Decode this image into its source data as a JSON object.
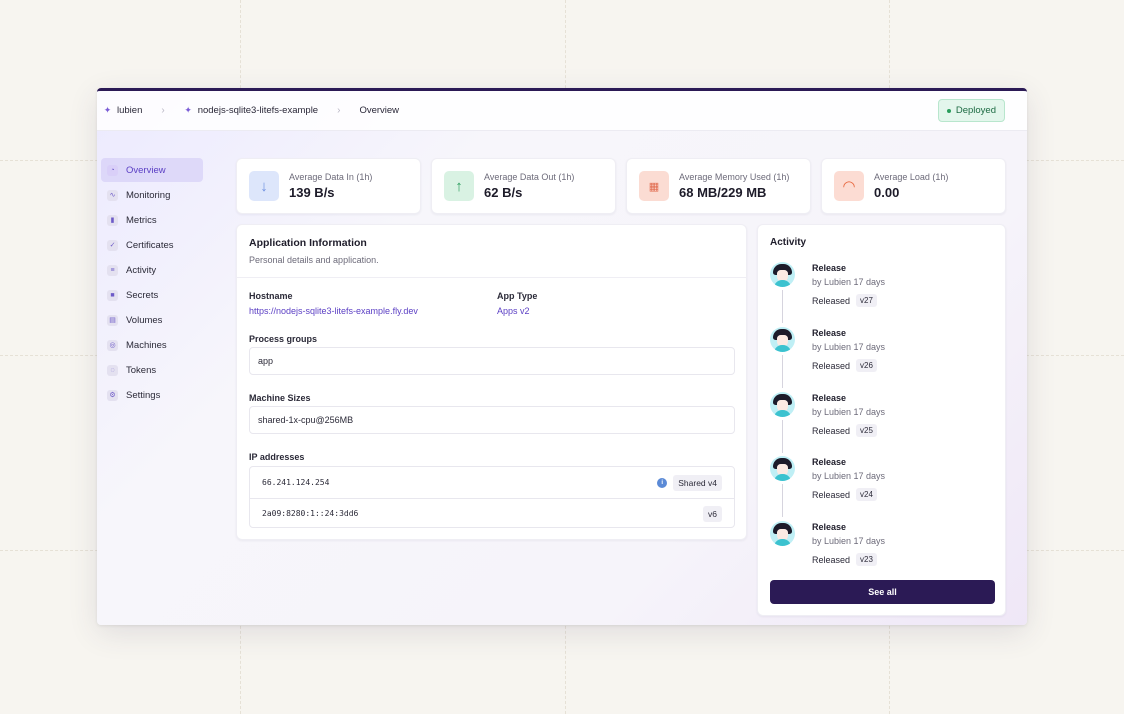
{
  "breadcrumb": {
    "org": "lubien",
    "app": "nodejs-sqlite3-litefs-example",
    "page": "Overview"
  },
  "status_badge": "Deployed",
  "sidebar": {
    "items": [
      {
        "label": "Overview",
        "icon": "overview-icon"
      },
      {
        "label": "Monitoring",
        "icon": "monitoring-icon"
      },
      {
        "label": "Metrics",
        "icon": "metrics-icon"
      },
      {
        "label": "Certificates",
        "icon": "certificates-icon"
      },
      {
        "label": "Activity",
        "icon": "activity-icon"
      },
      {
        "label": "Secrets",
        "icon": "secrets-icon"
      },
      {
        "label": "Volumes",
        "icon": "volumes-icon"
      },
      {
        "label": "Machines",
        "icon": "machines-icon"
      },
      {
        "label": "Tokens",
        "icon": "tokens-icon"
      },
      {
        "label": "Settings",
        "icon": "settings-icon"
      }
    ]
  },
  "stats": [
    {
      "label": "Average Data In (1h)",
      "value": "139 B/s",
      "icon": "download-icon",
      "color": "#6d8fe0"
    },
    {
      "label": "Average Data Out (1h)",
      "value": "62 B/s",
      "icon": "upload-icon",
      "color": "#2a9d5c"
    },
    {
      "label": "Average Memory Used (1h)",
      "value": "68 MB/229 MB",
      "icon": "memory-icon",
      "color": "#e06a4d"
    },
    {
      "label": "Average Load (1h)",
      "value": "0.00",
      "icon": "gauge-icon",
      "color": "#e8673e"
    }
  ],
  "app_info": {
    "title": "Application Information",
    "subtitle": "Personal details and application.",
    "hostname_label": "Hostname",
    "hostname": "https://nodejs-sqlite3-litefs-example.fly.dev",
    "app_type_label": "App Type",
    "app_type": "Apps v2",
    "process_groups_label": "Process groups",
    "process_groups": "app",
    "machine_sizes_label": "Machine Sizes",
    "machine_sizes": "shared-1x-cpu@256MB",
    "ip_label": "IP addresses",
    "ips": [
      {
        "address": "66.241.124.254",
        "type": "Shared v4"
      },
      {
        "address": "2a09:8280:1::24:3dd6",
        "type": "v6"
      }
    ]
  },
  "activity": {
    "title": "Activity",
    "items": [
      {
        "name": "Release",
        "by": "by Lubien 17 days",
        "status": "Released",
        "version": "v27"
      },
      {
        "name": "Release",
        "by": "by Lubien 17 days",
        "status": "Released",
        "version": "v26"
      },
      {
        "name": "Release",
        "by": "by Lubien 17 days",
        "status": "Released",
        "version": "v25"
      },
      {
        "name": "Release",
        "by": "by Lubien 17 days",
        "status": "Released",
        "version": "v24"
      },
      {
        "name": "Release",
        "by": "by Lubien 17 days",
        "status": "Released",
        "version": "v23"
      }
    ],
    "see_all": "See all"
  }
}
